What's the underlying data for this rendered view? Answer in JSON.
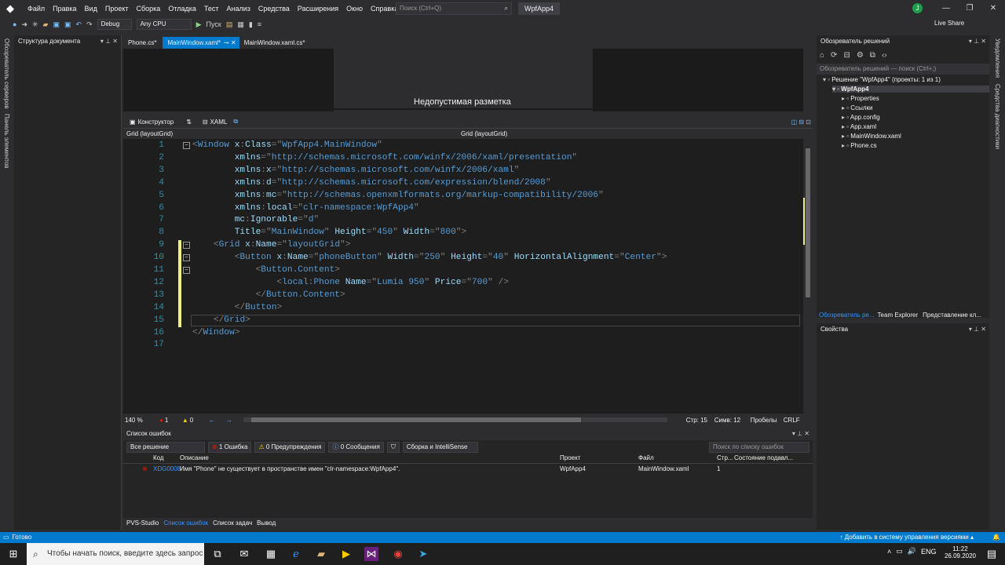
{
  "menu": [
    "Файл",
    "Правка",
    "Вид",
    "Проект",
    "Сборка",
    "Отладка",
    "Тест",
    "Анализ",
    "Средства",
    "Расширения",
    "Окно",
    "Справка"
  ],
  "search_placeholder": "Поиск (Ctrl+Q)",
  "window_title": "WpfApp4",
  "user_initial": "J",
  "toolbar": {
    "config": "Debug",
    "platform": "Any CPU",
    "run": "Пуск",
    "live_share": "Live Share"
  },
  "left_strip": [
    "Обозреватель серверов",
    "Панель элементов"
  ],
  "outline_title": "Структура документа",
  "tabs": [
    {
      "label": "Phone.cs*",
      "active": false
    },
    {
      "label": "MainWindow.xaml*",
      "active": true
    },
    {
      "label": "MainWindow.xaml.cs*",
      "active": false
    }
  ],
  "designer": {
    "invalid_text": "Недопустимая разметка",
    "constructor": "Конструктор",
    "xaml": "XAML"
  },
  "nav": {
    "left": "Grid (layoutGrid)",
    "right": "Grid (layoutGrid)"
  },
  "code_lines": [
    {
      "n": "1",
      "parts": [
        [
          "p",
          "<"
        ],
        [
          "t",
          "Window"
        ],
        [
          "k",
          " "
        ],
        [
          "a",
          "x"
        ],
        [
          "p",
          ":"
        ],
        [
          "a",
          "Class"
        ],
        [
          "p",
          "=\""
        ],
        [
          "t",
          "WpfApp4.MainWindow"
        ],
        [
          "p",
          "\""
        ]
      ]
    },
    {
      "n": "2",
      "parts": [
        [
          "k",
          "        "
        ],
        [
          "a",
          "xmlns"
        ],
        [
          "p",
          "=\""
        ],
        [
          "t",
          "http://schemas.microsoft.com/winfx/2006/xaml/presentation"
        ],
        [
          "p",
          "\""
        ]
      ]
    },
    {
      "n": "3",
      "parts": [
        [
          "k",
          "        "
        ],
        [
          "a",
          "xmlns"
        ],
        [
          "p",
          ":"
        ],
        [
          "a",
          "x"
        ],
        [
          "p",
          "=\""
        ],
        [
          "t",
          "http://schemas.microsoft.com/winfx/2006/xaml"
        ],
        [
          "p",
          "\""
        ]
      ]
    },
    {
      "n": "4",
      "parts": [
        [
          "k",
          "        "
        ],
        [
          "a",
          "xmlns"
        ],
        [
          "p",
          ":"
        ],
        [
          "a",
          "d"
        ],
        [
          "p",
          "=\""
        ],
        [
          "t",
          "http://schemas.microsoft.com/expression/blend/2008"
        ],
        [
          "p",
          "\""
        ]
      ]
    },
    {
      "n": "5",
      "parts": [
        [
          "k",
          "        "
        ],
        [
          "a",
          "xmlns"
        ],
        [
          "p",
          ":"
        ],
        [
          "a",
          "mc"
        ],
        [
          "p",
          "=\""
        ],
        [
          "t",
          "http://schemas.openxmlformats.org/markup-compatibility/2006"
        ],
        [
          "p",
          "\""
        ]
      ]
    },
    {
      "n": "6",
      "parts": [
        [
          "k",
          "        "
        ],
        [
          "a",
          "xmlns"
        ],
        [
          "p",
          ":"
        ],
        [
          "a",
          "local"
        ],
        [
          "p",
          "=\""
        ],
        [
          "t",
          "clr-namespace:WpfApp4"
        ],
        [
          "p",
          "\""
        ]
      ]
    },
    {
      "n": "7",
      "parts": [
        [
          "k",
          "        "
        ],
        [
          "a",
          "mc"
        ],
        [
          "p",
          ":"
        ],
        [
          "a",
          "Ignorable"
        ],
        [
          "p",
          "=\""
        ],
        [
          "t",
          "d"
        ],
        [
          "p",
          "\""
        ]
      ]
    },
    {
      "n": "8",
      "parts": [
        [
          "k",
          "        "
        ],
        [
          "a",
          "Title"
        ],
        [
          "p",
          "=\""
        ],
        [
          "t",
          "MainWindow"
        ],
        [
          "p",
          "\" "
        ],
        [
          "a",
          "Height"
        ],
        [
          "p",
          "=\""
        ],
        [
          "t",
          "450"
        ],
        [
          "p",
          "\" "
        ],
        [
          "a",
          "Width"
        ],
        [
          "p",
          "=\""
        ],
        [
          "t",
          "800"
        ],
        [
          "p",
          "\">"
        ]
      ]
    },
    {
      "n": "9",
      "parts": [
        [
          "k",
          "    "
        ],
        [
          "p",
          "<"
        ],
        [
          "t",
          "Grid"
        ],
        [
          "k",
          " "
        ],
        [
          "a",
          "x"
        ],
        [
          "p",
          ":"
        ],
        [
          "a",
          "Name"
        ],
        [
          "p",
          "=\""
        ],
        [
          "t",
          "layoutGrid"
        ],
        [
          "p",
          "\">"
        ]
      ]
    },
    {
      "n": "10",
      "parts": [
        [
          "k",
          "        "
        ],
        [
          "p",
          "<"
        ],
        [
          "t",
          "Button"
        ],
        [
          "k",
          " "
        ],
        [
          "a",
          "x"
        ],
        [
          "p",
          ":"
        ],
        [
          "a",
          "Name"
        ],
        [
          "p",
          "=\""
        ],
        [
          "t",
          "phoneButton"
        ],
        [
          "p",
          "\" "
        ],
        [
          "a",
          "Width"
        ],
        [
          "p",
          "=\""
        ],
        [
          "t",
          "250"
        ],
        [
          "p",
          "\" "
        ],
        [
          "a",
          "Height"
        ],
        [
          "p",
          "=\""
        ],
        [
          "t",
          "40"
        ],
        [
          "p",
          "\" "
        ],
        [
          "a",
          "HorizontalAlignment"
        ],
        [
          "p",
          "=\""
        ],
        [
          "t",
          "Center"
        ],
        [
          "p",
          "\">"
        ]
      ]
    },
    {
      "n": "11",
      "parts": [
        [
          "k",
          "            "
        ],
        [
          "p",
          "<"
        ],
        [
          "t",
          "Button.Content"
        ],
        [
          "p",
          ">"
        ]
      ]
    },
    {
      "n": "12",
      "parts": [
        [
          "k",
          "                "
        ],
        [
          "p",
          "<"
        ],
        [
          "t",
          "local"
        ],
        [
          "p",
          ":"
        ],
        [
          "t",
          "Phone"
        ],
        [
          "k",
          " "
        ],
        [
          "a",
          "Name"
        ],
        [
          "p",
          "=\""
        ],
        [
          "t",
          "Lumia 950"
        ],
        [
          "p",
          "\" "
        ],
        [
          "a",
          "Price"
        ],
        [
          "p",
          "=\""
        ],
        [
          "t",
          "700"
        ],
        [
          "p",
          "\" />"
        ]
      ]
    },
    {
      "n": "13",
      "parts": [
        [
          "k",
          "            "
        ],
        [
          "p",
          "</"
        ],
        [
          "t",
          "Button.Content"
        ],
        [
          "p",
          ">"
        ]
      ]
    },
    {
      "n": "14",
      "parts": [
        [
          "k",
          "        "
        ],
        [
          "p",
          "</"
        ],
        [
          "t",
          "Button"
        ],
        [
          "p",
          ">"
        ]
      ]
    },
    {
      "n": "15",
      "parts": [
        [
          "k",
          "    "
        ],
        [
          "p",
          "</"
        ],
        [
          "t",
          "Grid"
        ],
        [
          "p",
          ">"
        ]
      ]
    },
    {
      "n": "16",
      "parts": [
        [
          "p",
          "</"
        ],
        [
          "t",
          "Window"
        ],
        [
          "p",
          ">"
        ]
      ]
    },
    {
      "n": "17",
      "parts": []
    }
  ],
  "code_status": {
    "zoom": "140 %",
    "errors": "1",
    "warnings": "0",
    "line": "Стр: 15",
    "col": "Симв: 12",
    "spaces": "Пробелы",
    "eol": "CRLF"
  },
  "error_list": {
    "title": "Список ошибок",
    "scope": "Все решение",
    "errors_btn": "1 Ошибка",
    "warnings_btn": "0 Предупреждения",
    "messages_btn": "0 Сообщения",
    "build_filter": "Сборка и IntelliSense",
    "search_placeholder": "Поиск по списку ошибок",
    "headers": [
      "Код",
      "Описание",
      "Проект",
      "Файл",
      "Стр...",
      "Состояние подавл..."
    ],
    "rows": [
      {
        "code": "XDG0008",
        "desc": "Имя \"Phone\" не существует в пространстве имен \"clr-namespace:WpfApp4\".",
        "project": "WpfApp4",
        "file": "MainWindow.xaml",
        "line": "1",
        "state": ""
      }
    ]
  },
  "bottom_tabs": [
    "PVS-Studio",
    "Список ошибок",
    "Список задач",
    "Вывод"
  ],
  "solution": {
    "title": "Обозреватель решений",
    "search": "Обозреватель решений — поиск (Ctrl+;)",
    "items": [
      {
        "label": "Решение \"WpfApp4\" (проекты: 1 из 1)",
        "indent": 0
      },
      {
        "label": "WpfApp4",
        "indent": 1
      },
      {
        "label": "Properties",
        "indent": 2
      },
      {
        "label": "Ссылки",
        "indent": 2
      },
      {
        "label": "App.config",
        "indent": 2
      },
      {
        "label": "App.xaml",
        "indent": 2
      },
      {
        "label": "MainWindow.xaml",
        "indent": 2
      },
      {
        "label": "Phone.cs",
        "indent": 2
      }
    ],
    "bottom_tabs": [
      "Обозреватель ре...",
      "Team Explorer",
      "Представление кл..."
    ]
  },
  "properties_title": "Свойства",
  "right_strip": [
    "Уведомления",
    "Средства диагностики"
  ],
  "statusbar": {
    "ready": "Готово",
    "vcs": "Добавить в систему управления версиями"
  },
  "taskbar": {
    "search": "Чтобы начать поиск, введите здесь запрос",
    "lang": "ENG",
    "time": "11:22",
    "date": "26.09.2020"
  }
}
